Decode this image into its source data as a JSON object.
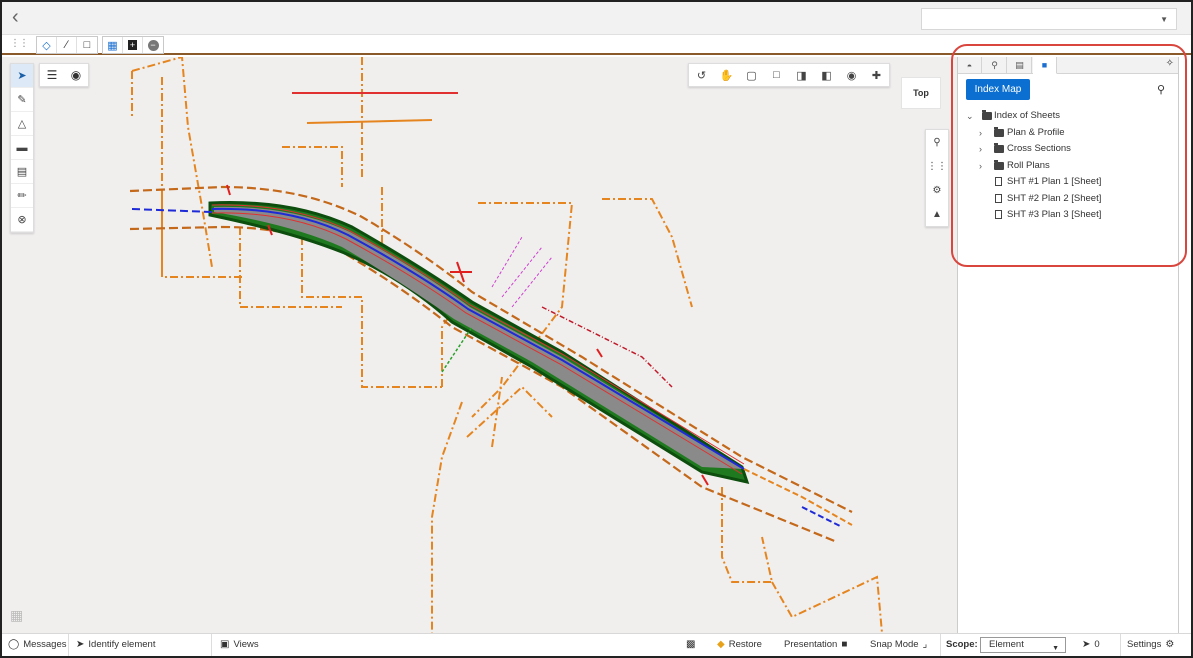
{
  "topbar": {
    "back_icon": "chevron-left-icon",
    "dropdown_value": ""
  },
  "toolrow": {
    "tools": [
      "place-point-icon",
      "place-line-icon",
      "place-rectangle-icon",
      "select-element-icon",
      "add-icon",
      "remove-icon"
    ]
  },
  "viewport": {
    "left_tools": [
      "select-arrow-icon",
      "measure-icon",
      "surface-icon",
      "roadway-icon",
      "corridor-icon",
      "ruler-icon",
      "navigate-icon"
    ],
    "menu_tools": [
      "hamburger-menu-icon",
      "visibility-eye-icon"
    ],
    "nav_tools": [
      "rotate-icon",
      "pan-hand-icon",
      "fit-view-icon",
      "window-area-icon",
      "view-previous-icon",
      "view-next-icon",
      "camera-icon",
      "walk-icon"
    ],
    "cube_label": "Top",
    "right_tools": [
      "zoom-icon",
      "footprints-icon",
      "markup-icon",
      "terrain-icon"
    ]
  },
  "panel": {
    "tabs": [
      "hierarchy-icon",
      "search-icon",
      "properties-icon",
      "sheets-icon"
    ],
    "index_map_label": "Index Map",
    "tree": {
      "root": "Index of Sheets",
      "folders": [
        "Plan & Profile",
        "Cross Sections",
        "Roll Plans"
      ],
      "sheets": [
        "SHT #1 Plan 1 [Sheet]",
        "SHT #2 Plan 2 [Sheet]",
        "SHT #3 Plan 3 [Sheet]"
      ]
    }
  },
  "status": {
    "messages": "Messages",
    "identify": "Identify element",
    "views": "Views",
    "restore": "Restore",
    "presentation": "Presentation",
    "snap_mode": "Snap Mode",
    "scope_label": "Scope:",
    "scope_value": "Element",
    "selection_count": "0",
    "settings": "Settings"
  },
  "colors": {
    "accent": "#0a6fd0",
    "highlight_ring": "#d9463e",
    "road_green": "#1e7a1e",
    "boundary_orange": "#e5851f"
  }
}
